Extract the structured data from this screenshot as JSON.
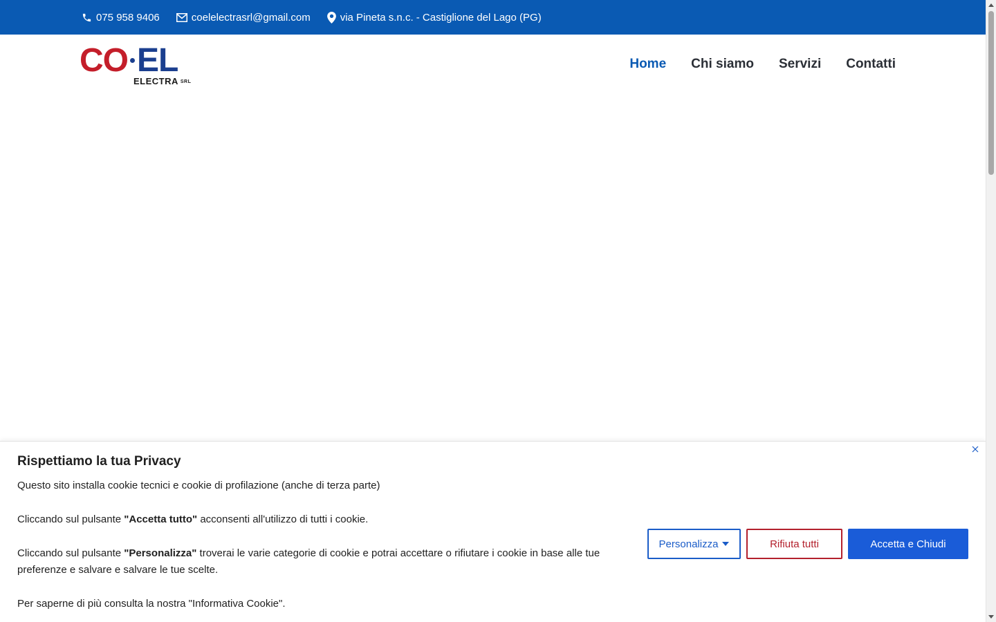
{
  "topbar": {
    "phone": "075 958 9406",
    "email": "coelelectrasrl@gmail.com",
    "address": "via Pineta s.n.c. - Castiglione del Lago (PG)",
    "background_color": "#0a5ab3"
  },
  "logo": {
    "part1": "CO",
    "part2": "EL",
    "sub": "ELECTRA",
    "srl": "SRL"
  },
  "nav": {
    "items": [
      {
        "label": "Home",
        "active": true
      },
      {
        "label": "Chi siamo",
        "active": false
      },
      {
        "label": "Servizi",
        "active": false
      },
      {
        "label": "Contatti",
        "active": false
      }
    ],
    "active_color": "#0a5ab3"
  },
  "cookie": {
    "title": "Rispettiamo la tua Privacy",
    "paragraph1": "Questo sito installa cookie tecnici e cookie di profilazione (anche di terza parte)",
    "p2_before": "Cliccando sul pulsante ",
    "p2_bold": "\"Accetta tutto\"",
    "p2_after": " acconsenti all'utilizzo di tutti i cookie.",
    "p3_before": "Cliccando sul pulsante ",
    "p3_bold": "\"Personalizza\"",
    "p3_after": " troverai le varie categorie di cookie e potrai accettare o rifiutare i cookie in base alle tue preferenze e salvare e salvare le tue scelte.",
    "paragraph4": "Per saperne di più consulta la nostra \"Informativa Cookie\".",
    "buttons": {
      "customize": "Personalizza",
      "reject": "Rifiuta tutti",
      "accept": "Accetta e Chiudi"
    },
    "accept_color": "#1a5cd8",
    "reject_color": "#b3202c"
  }
}
